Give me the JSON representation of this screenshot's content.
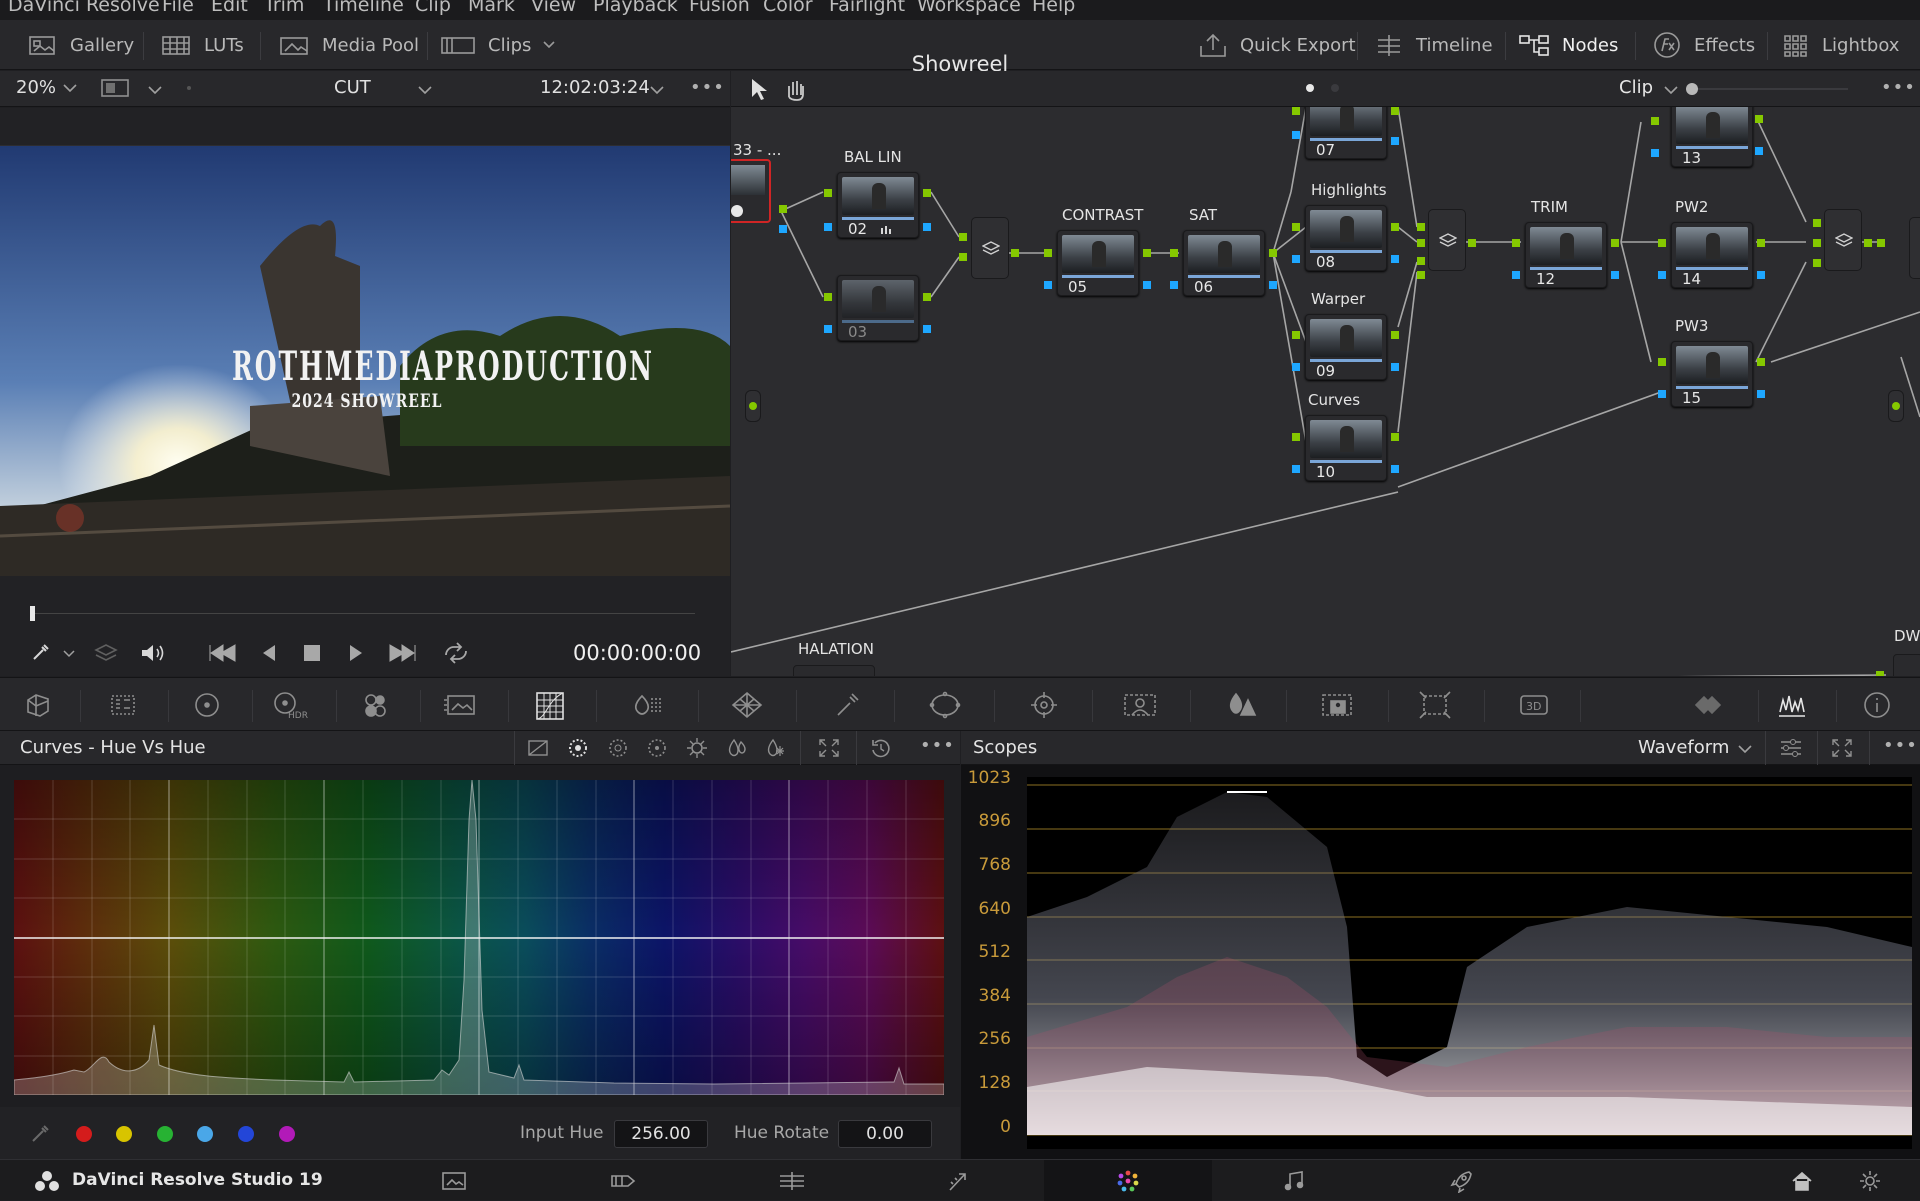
{
  "menubar": {
    "items": [
      "DaVinci Resolve",
      "File",
      "Edit",
      "Trim",
      "Timeline",
      "Clip",
      "Mark",
      "View",
      "Playback",
      "Fusion",
      "Color",
      "Fairlight",
      "Workspace",
      "Help"
    ]
  },
  "toolbar": {
    "left": [
      "Gallery",
      "LUTs",
      "Media Pool",
      "Clips"
    ],
    "title": "Showreel",
    "right": [
      "Quick Export",
      "Timeline",
      "Nodes",
      "Effects",
      "Lightbox"
    ]
  },
  "viewer": {
    "zoom": "20%",
    "mode": "CUT",
    "timecode": "12:02:03:24",
    "overlay_title": "ROTHMEDIAPRODUCTION",
    "overlay_subtitle": "2024 SHOWREEL",
    "playback_time": "00:00:00:00"
  },
  "nodes": {
    "mode": "Clip",
    "items": [
      {
        "label": "BAL LIN",
        "num": "02"
      },
      {
        "label": "",
        "num": "03"
      },
      {
        "label": "CONTRAST",
        "num": "05"
      },
      {
        "label": "SAT",
        "num": "06"
      },
      {
        "label": "",
        "num": "07"
      },
      {
        "label": "Highlights",
        "num": "08"
      },
      {
        "label": "Warper",
        "num": "09"
      },
      {
        "label": "Curves",
        "num": "10"
      },
      {
        "label": "TRIM",
        "num": "12"
      },
      {
        "label": "",
        "num": "13"
      },
      {
        "label": "PW2",
        "num": "14"
      },
      {
        "label": "PW3",
        "num": "15"
      }
    ],
    "partial_left": "33 - ...",
    "halation": "HALATION",
    "partial_right": "DW"
  },
  "curves": {
    "title": "Curves - Hue Vs Hue",
    "input_hue_label": "Input Hue",
    "input_hue_value": "256.00",
    "hue_rotate_label": "Hue Rotate",
    "hue_rotate_value": "0.00",
    "swatches": [
      "#d41c1c",
      "#d8c400",
      "#27b233",
      "#4aa7e8",
      "#2346d8",
      "#b21ab8"
    ]
  },
  "scopes": {
    "title": "Scopes",
    "type": "Waveform",
    "y_labels": [
      "1023",
      "896",
      "768",
      "640",
      "512",
      "384",
      "256",
      "128",
      "0"
    ]
  },
  "pagebar": {
    "app_name": "DaVinci Resolve Studio 19"
  }
}
